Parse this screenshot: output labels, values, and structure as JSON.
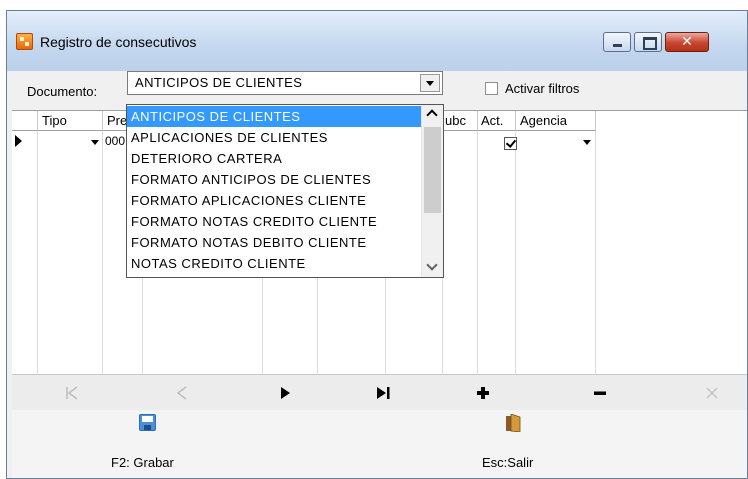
{
  "window": {
    "title": "Registro de consecutivos"
  },
  "filter": {
    "documento_label": "Documento:",
    "documento_value": "ANTICIPOS DE CLIENTES",
    "activar_filtros_label": "Activar filtros",
    "activar_filtros_checked": false
  },
  "grid": {
    "columns": [
      "Tipo",
      "Pre",
      "ubc",
      "Act.",
      "Agencia"
    ],
    "row": {
      "prefijo": "000",
      "act_checked": true
    }
  },
  "dropdown": {
    "selected_index": 0,
    "items": [
      "ANTICIPOS DE CLIENTES",
      "APLICACIONES DE CLIENTES",
      "DETERIORO CARTERA",
      "FORMATO ANTICIPOS DE CLIENTES",
      "FORMATO APLICACIONES CLIENTE",
      "FORMATO NOTAS CREDITO CLIENTE",
      "FORMATO NOTAS DEBITO CLIENTE",
      "NOTAS CREDITO CLIENTE"
    ]
  },
  "navigator": {
    "buttons": [
      "first-icon",
      "prior-icon",
      "next-icon",
      "last-icon",
      "insert-icon",
      "delete-icon",
      "cancel-icon"
    ]
  },
  "actions": {
    "save_label": "F2: Grabar",
    "exit_label": "Esc:Salir"
  },
  "colors": {
    "selection": "#3399ff",
    "close_button": "#c8452f"
  }
}
